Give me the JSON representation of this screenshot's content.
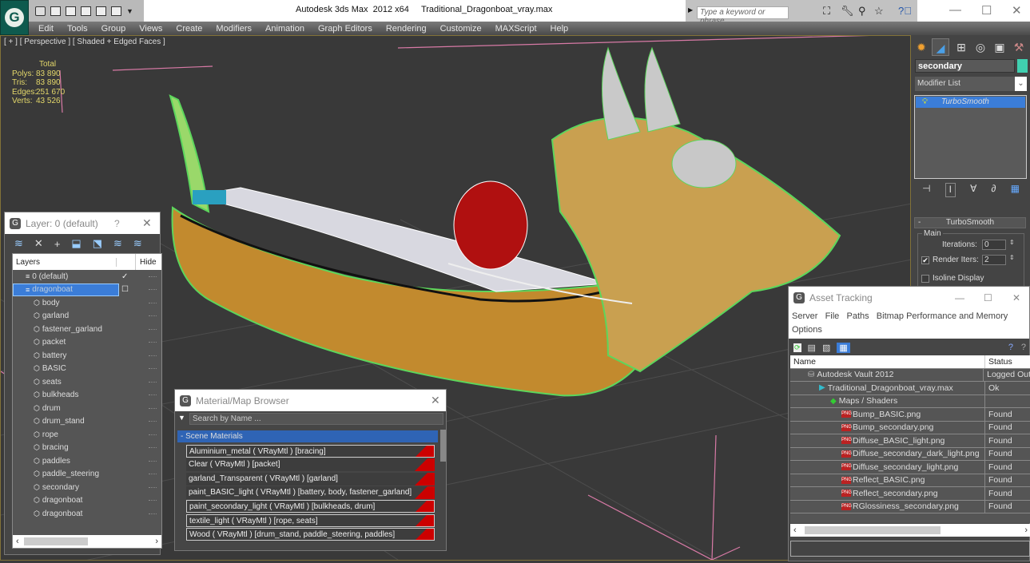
{
  "window": {
    "title": "Autodesk 3ds Max  2012 x64     Traditional_Dragonboat_vray.max",
    "search_placeholder": "Type a keyword or phrase",
    "minimize": "—",
    "maximize": "☐",
    "close": "✕"
  },
  "menu": [
    "Edit",
    "Tools",
    "Group",
    "Views",
    "Create",
    "Modifiers",
    "Animation",
    "Graph Editors",
    "Rendering",
    "Customize",
    "MAXScript",
    "Help"
  ],
  "viewport": {
    "label": "[ + ] [ Perspective ] [ Shaded + Edged Faces ]",
    "stats": {
      "header": "Total",
      "rows": [
        {
          "label": "Polys:",
          "value": "83 890"
        },
        {
          "label": "Tris:",
          "value": "83 890"
        },
        {
          "label": "Edges:",
          "value": "251 670"
        },
        {
          "label": "Verts:",
          "value": "43 526"
        }
      ]
    }
  },
  "command_panel": {
    "object_name": "secondary",
    "object_color": "#40d0b0",
    "modifier_list_label": "Modifier List",
    "stack_item": "TurboSmooth",
    "rollout_title": "TurboSmooth",
    "group_label": "Main",
    "iterations_label": "Iterations:",
    "iterations_value": "0",
    "render_iters_label": "Render Iters:",
    "render_iters_value": "2",
    "render_iters_checked": true,
    "isoline_label": "Isoline Display",
    "isoline_checked": false
  },
  "layer_dialog": {
    "title": "Layer: 0 (default)",
    "help": "?",
    "close": "✕",
    "col_layers": "Layers",
    "col_hide": "Hide",
    "layers": [
      {
        "name": "0 (default)",
        "type": "layer",
        "level": 0,
        "current": true
      },
      {
        "name": "dragonboat",
        "type": "layer",
        "level": 0,
        "selected": true
      },
      {
        "name": "body",
        "type": "object",
        "level": 1
      },
      {
        "name": "garland",
        "type": "object",
        "level": 1
      },
      {
        "name": "fastener_garland",
        "type": "object",
        "level": 1
      },
      {
        "name": "packet",
        "type": "object",
        "level": 1
      },
      {
        "name": "battery",
        "type": "object",
        "level": 1
      },
      {
        "name": "BASIC",
        "type": "object",
        "level": 1
      },
      {
        "name": "seats",
        "type": "object",
        "level": 1
      },
      {
        "name": "bulkheads",
        "type": "object",
        "level": 1
      },
      {
        "name": "drum",
        "type": "object",
        "level": 1
      },
      {
        "name": "drum_stand",
        "type": "object",
        "level": 1
      },
      {
        "name": "rope",
        "type": "object",
        "level": 1
      },
      {
        "name": "bracing",
        "type": "object",
        "level": 1
      },
      {
        "name": "paddles",
        "type": "object",
        "level": 1
      },
      {
        "name": "paddle_steering",
        "type": "object",
        "level": 1
      },
      {
        "name": "secondary",
        "type": "object",
        "level": 1
      },
      {
        "name": "dragonboat",
        "type": "object",
        "level": 1
      },
      {
        "name": "dragonboat",
        "type": "object",
        "level": 1
      }
    ]
  },
  "material_browser": {
    "title": "Material/Map Browser",
    "close": "✕",
    "search_placeholder": "Search by Name ...",
    "section": "- Scene Materials",
    "materials": [
      {
        "label": "Aluminium_metal  ( VRayMtl ) [bracing]",
        "outlined": true
      },
      {
        "label": "Clear  ( VRayMtl ) [packet]",
        "outlined": false
      },
      {
        "label": "garland_Transparent  ( VRayMtl ) [garland]",
        "outlined": false
      },
      {
        "label": "paint_BASIC_light  ( VRayMtl ) [battery, body, fastener_garland]",
        "outlined": false
      },
      {
        "label": "paint_secondary_light  ( VRayMtl ) [bulkheads, drum]",
        "outlined": true
      },
      {
        "label": "textile_light  ( VRayMtl ) [rope, seats]",
        "outlined": true
      },
      {
        "label": "Wood  ( VRayMtl ) [drum_stand, paddle_steering, paddles]",
        "outlined": true
      }
    ]
  },
  "asset_tracking": {
    "title": "Asset Tracking",
    "menu": [
      "Server",
      "File",
      "Paths",
      "Bitmap Performance and Memory",
      "Options"
    ],
    "col_name": "Name",
    "col_status": "Status",
    "rows": [
      {
        "name": "Autodesk Vault 2012",
        "status": "Logged Out",
        "level": 1,
        "icon": "vault"
      },
      {
        "name": "Traditional_Dragonboat_vray.max",
        "status": "Ok",
        "level": 2,
        "icon": "max"
      },
      {
        "name": "Maps / Shaders",
        "status": "",
        "level": 3,
        "icon": "maps"
      },
      {
        "name": "Bump_BASIC.png",
        "status": "Found",
        "level": 4,
        "icon": "png"
      },
      {
        "name": "Bump_secondary.png",
        "status": "Found",
        "level": 4,
        "icon": "png"
      },
      {
        "name": "Diffuse_BASIC_light.png",
        "status": "Found",
        "level": 4,
        "icon": "png"
      },
      {
        "name": "Diffuse_secondary_dark_light.png",
        "status": "Found",
        "level": 4,
        "icon": "png"
      },
      {
        "name": "Diffuse_secondary_light.png",
        "status": "Found",
        "level": 4,
        "icon": "png"
      },
      {
        "name": "Reflect_BASIC.png",
        "status": "Found",
        "level": 4,
        "icon": "png"
      },
      {
        "name": "Reflect_secondary.png",
        "status": "Found",
        "level": 4,
        "icon": "png"
      },
      {
        "name": "RGlossiness_secondary.png",
        "status": "Found",
        "level": 4,
        "icon": "png"
      }
    ]
  }
}
